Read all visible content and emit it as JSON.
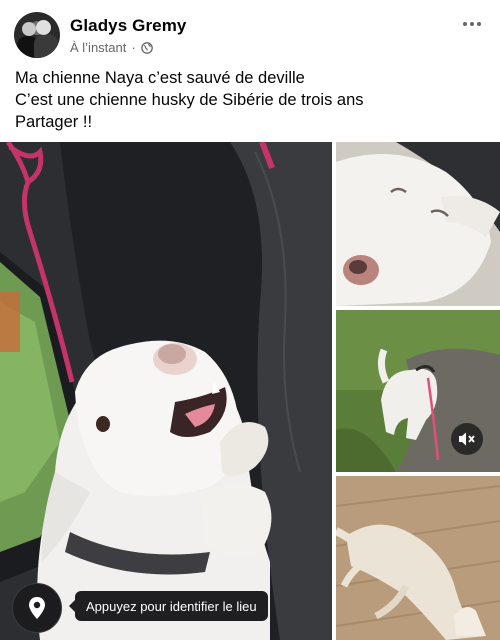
{
  "post": {
    "author": "Gladys Gremy",
    "timestamp": "À l’instant",
    "separator": "·",
    "privacy_icon": "globe-icon",
    "more_icon": "more-options-icon",
    "text_lines": [
      "Ma chienne Naya c’est sauvé de deville",
      "C’est une chienne husky de Sibérie de trois ans",
      "Partager !!"
    ]
  },
  "media": {
    "location_icon": "location-pin-icon",
    "location_tooltip": "Appuyez pour identifier le lieu",
    "mute_icon": "speaker-muted-icon"
  },
  "colors": {
    "text": "#050505",
    "meta": "#65676b",
    "overlay": "#1f1f21"
  }
}
